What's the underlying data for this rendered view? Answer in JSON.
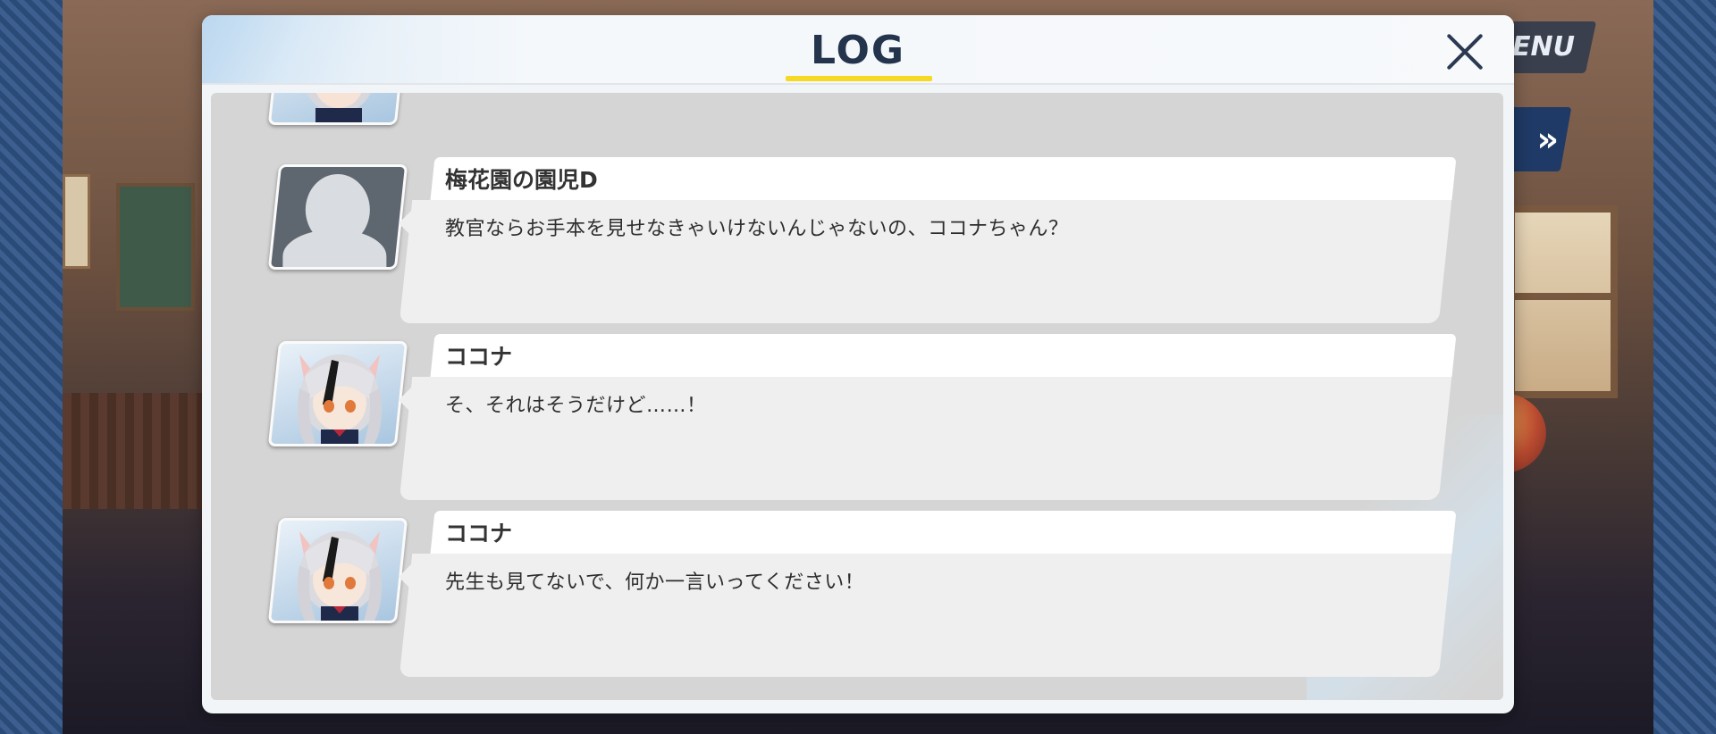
{
  "dialog": {
    "title": "LOG",
    "close_icon": "close-icon"
  },
  "menu": {
    "label": "ENU"
  },
  "skip": {
    "label": "»"
  },
  "entries": [
    {
      "speaker": "",
      "text": "",
      "avatar": "character-portrait"
    },
    {
      "speaker": "梅花園の園児D",
      "text": "教官ならお手本を見せなきゃいけないんじゃないの、ココナちゃん？",
      "avatar": "silhouette-placeholder"
    },
    {
      "speaker": "ココナ",
      "text": "そ、それはそうだけど……！",
      "avatar": "kokona-portrait"
    },
    {
      "speaker": "ココナ",
      "text": "先生も見てないで、何か一言いってください！",
      "avatar": "kokona-portrait"
    }
  ],
  "colors": {
    "title": "#24344d",
    "underline": "#f5d922",
    "log_bg": "#d5d5d5",
    "bubble": "#efefef",
    "name_plate": "#ffffff"
  }
}
